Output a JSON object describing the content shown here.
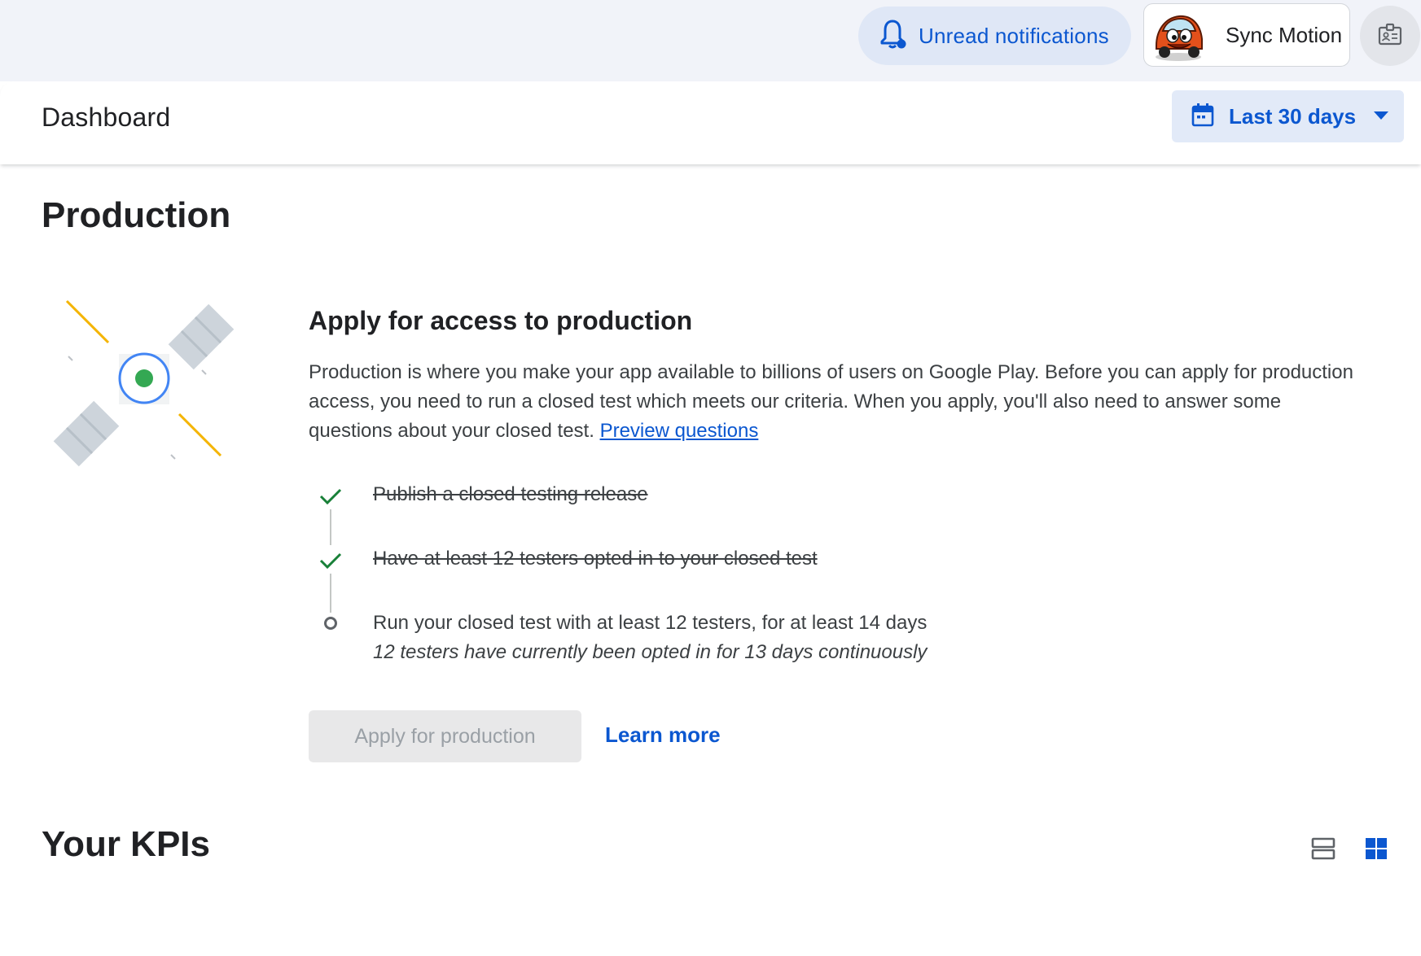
{
  "topbar": {
    "notifications_label": "Unread notifications",
    "account_name": "Sync Motion"
  },
  "header": {
    "title": "Dashboard",
    "date_range_label": "Last 30 days"
  },
  "production": {
    "section_title": "Production",
    "card_title": "Apply for access to production",
    "description": "Production is where you make your app available to billions of users on Google Play. Before you can apply for production access, you need to run a closed test which meets our criteria. When you apply, you'll also need to answer some questions about your closed test.",
    "preview_link": "Preview questions",
    "steps": [
      {
        "label": "Publish a closed testing release",
        "status": "complete"
      },
      {
        "label": "Have at least 12 testers opted in to your closed test",
        "status": "complete"
      },
      {
        "label": "Run your closed test with at least 12 testers, for at least 14 days",
        "status": "pending",
        "detail": "12 testers have currently been opted in for 13 days continuously"
      }
    ],
    "apply_button": "Apply for production",
    "learn_more": "Learn more"
  },
  "kpis": {
    "title": "Your KPIs",
    "view_options": [
      "list-view",
      "grid-view"
    ],
    "selected_view": "grid-view"
  },
  "colors": {
    "accent_blue": "#0b57d0",
    "check_green": "#188038",
    "disabled_bg": "#e8e8e9"
  }
}
